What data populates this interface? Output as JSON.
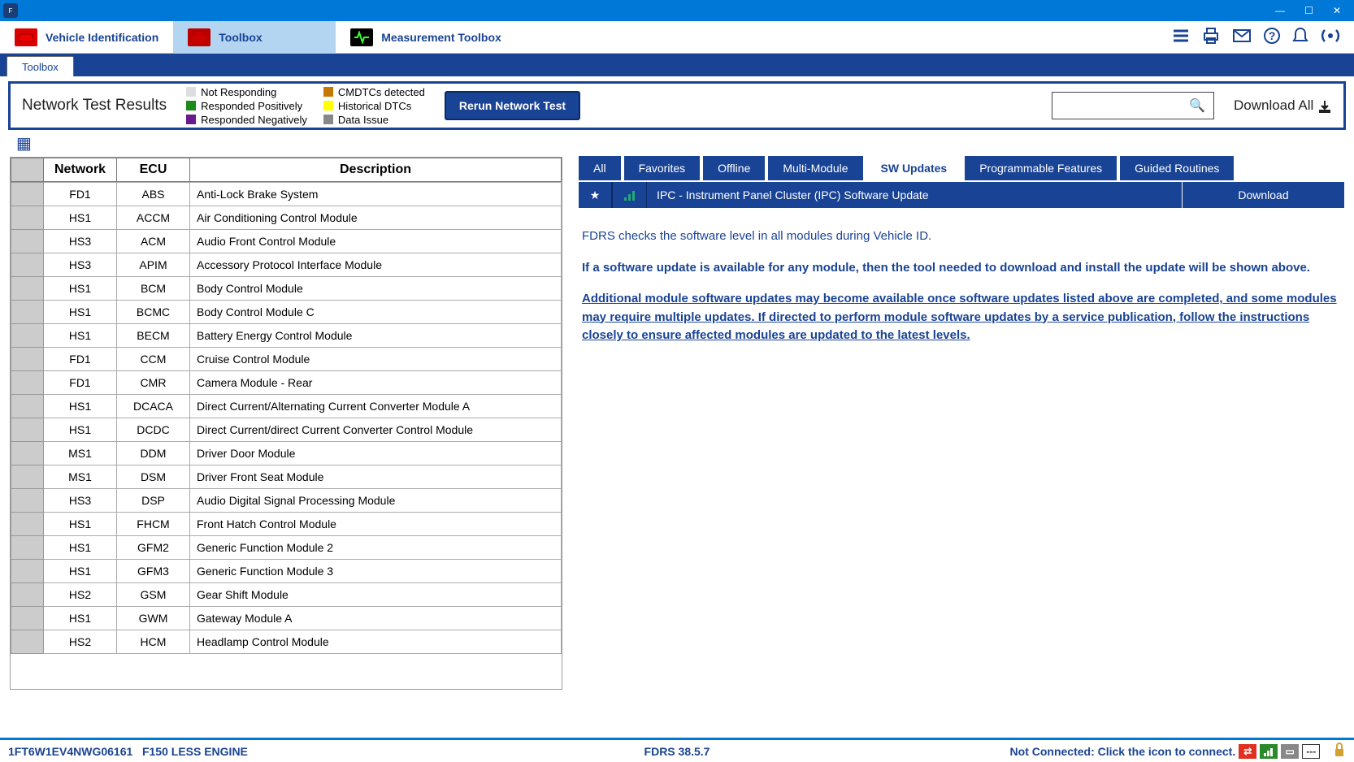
{
  "titlebar": {
    "app": "FDRS"
  },
  "main_tabs": {
    "vehicle": "Vehicle Identification",
    "toolbox": "Toolbox",
    "measurement": "Measurement Toolbox"
  },
  "subtab": "Toolbox",
  "network": {
    "title": "Network Test Results",
    "legend": {
      "not_responding": "Not Responding",
      "responded_positively": "Responded Positively",
      "responded_negatively": "Responded Negatively",
      "cmdtcs_detected": "CMDTCs detected",
      "historical_dtcs": "Historical DTCs",
      "data_issue": "Data Issue"
    },
    "rerun_btn": "Rerun Network Test",
    "download_all": "Download All"
  },
  "table": {
    "headers": {
      "network": "Network",
      "ecu": "ECU",
      "description": "Description"
    },
    "rows": [
      {
        "net": "FD1",
        "ecu": "ABS",
        "desc": "Anti-Lock Brake System"
      },
      {
        "net": "HS1",
        "ecu": "ACCM",
        "desc": "Air Conditioning Control Module"
      },
      {
        "net": "HS3",
        "ecu": "ACM",
        "desc": "Audio Front Control Module"
      },
      {
        "net": "HS3",
        "ecu": "APIM",
        "desc": "Accessory Protocol Interface Module"
      },
      {
        "net": "HS1",
        "ecu": "BCM",
        "desc": "Body Control Module"
      },
      {
        "net": "HS1",
        "ecu": "BCMC",
        "desc": "Body Control Module C"
      },
      {
        "net": "HS1",
        "ecu": "BECM",
        "desc": "Battery Energy Control Module"
      },
      {
        "net": "FD1",
        "ecu": "CCM",
        "desc": "Cruise Control Module"
      },
      {
        "net": "FD1",
        "ecu": "CMR",
        "desc": "Camera Module - Rear"
      },
      {
        "net": "HS1",
        "ecu": "DCACA",
        "desc": "Direct Current/Alternating Current Converter Module A"
      },
      {
        "net": "HS1",
        "ecu": "DCDC",
        "desc": "Direct Current/direct Current Converter Control Module"
      },
      {
        "net": "MS1",
        "ecu": "DDM",
        "desc": "Driver Door Module"
      },
      {
        "net": "MS1",
        "ecu": "DSM",
        "desc": "Driver Front Seat Module"
      },
      {
        "net": "HS3",
        "ecu": "DSP",
        "desc": "Audio Digital Signal Processing Module"
      },
      {
        "net": "HS1",
        "ecu": "FHCM",
        "desc": "Front Hatch Control Module"
      },
      {
        "net": "HS1",
        "ecu": "GFM2",
        "desc": "Generic Function Module 2"
      },
      {
        "net": "HS1",
        "ecu": "GFM3",
        "desc": "Generic Function Module 3"
      },
      {
        "net": "HS2",
        "ecu": "GSM",
        "desc": "Gear Shift Module"
      },
      {
        "net": "HS1",
        "ecu": "GWM",
        "desc": "Gateway Module A"
      },
      {
        "net": "HS2",
        "ecu": "HCM",
        "desc": "Headlamp Control Module"
      }
    ]
  },
  "filters": {
    "all": "All",
    "favorites": "Favorites",
    "offline": "Offline",
    "multi": "Multi-Module",
    "sw": "SW Updates",
    "prog": "Programmable Features",
    "guided": "Guided Routines"
  },
  "update": {
    "name": "IPC - Instrument Panel Cluster (IPC) Software Update",
    "download": "Download"
  },
  "info": {
    "line1": "FDRS checks the software level in all modules during Vehicle ID.",
    "line2": "If a software update is available for any module, then the tool needed to download and install the update will be shown above.",
    "line3": "Additional module software updates may become available once software updates listed above are completed, and some modules may require multiple updates. If directed to perform module software updates by a service publication, follow the instructions closely to ensure affected modules are updated to the latest levels."
  },
  "status": {
    "vin": "1FT6W1EV4NWG06161",
    "vehicle": "F150 LESS ENGINE",
    "version": "FDRS 38.5.7",
    "connect": "Not Connected: Click the icon to connect."
  }
}
